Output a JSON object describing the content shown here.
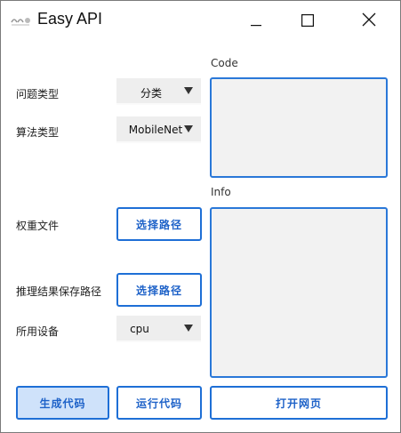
{
  "window": {
    "title": "Easy API"
  },
  "form": {
    "problem_type": {
      "label": "问题类型",
      "value": "分类"
    },
    "algorithm_type": {
      "label": "算法类型",
      "value": "MobileNet"
    },
    "weight_file": {
      "label": "权重文件",
      "button": "选择路径"
    },
    "result_path": {
      "label": "推理结果保存路径",
      "button": "选择路径"
    },
    "device": {
      "label": "所用设备",
      "value": "cpu"
    }
  },
  "panels": {
    "code_label": "Code",
    "info_label": "Info"
  },
  "actions": {
    "generate": "生成代码",
    "run": "运行代码",
    "open_page": "打开网页"
  },
  "colors": {
    "accent": "#1e6fd6",
    "primary_button_fill": "#cfe2fa",
    "select_fill": "#eeeeee",
    "textbox_fill": "#f2f2f2"
  }
}
